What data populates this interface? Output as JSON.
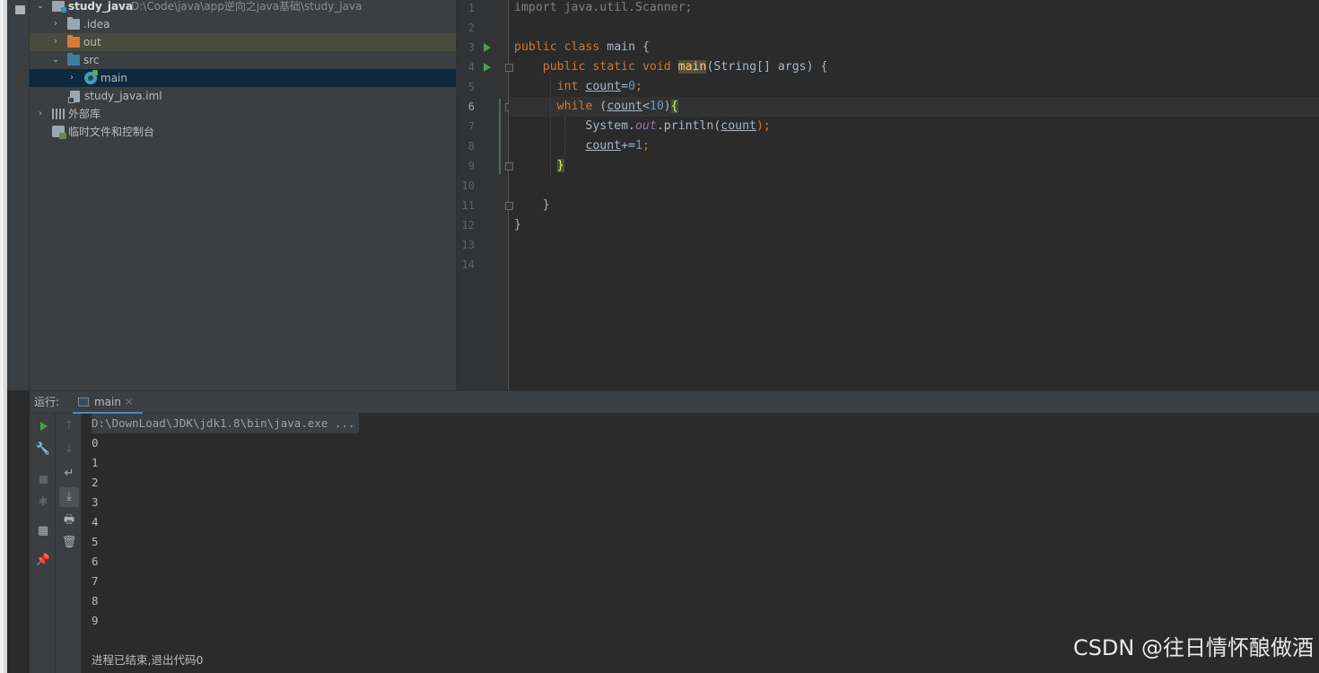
{
  "project": {
    "items": [
      {
        "arrow": "⌄",
        "label": "study_java",
        "path": "D:\\Code\\java\\app逆向之java基础\\study_java"
      },
      {
        "arrow": "›",
        "label": ".idea"
      },
      {
        "arrow": "›",
        "label": "out"
      },
      {
        "arrow": "⌄",
        "label": "src"
      },
      {
        "arrow": "›",
        "label": "main"
      },
      {
        "arrow": "",
        "label": "study_java.iml"
      },
      {
        "arrow": "›",
        "label": "外部库"
      },
      {
        "arrow": "",
        "label": "临时文件和控制台"
      }
    ]
  },
  "editor": {
    "line_numbers": [
      "1",
      "2",
      "3",
      "4",
      "5",
      "6",
      "7",
      "8",
      "9",
      "10",
      "11",
      "12",
      "13",
      "14"
    ],
    "current_line": "6",
    "lines": {
      "l1": {
        "text": "import java.util.Scanner;"
      },
      "l3": {
        "kw1": "public",
        "kw2": "class",
        "rest": "main {"
      },
      "l4": {
        "kw1": "public",
        "kw2": "static",
        "kw3": "void",
        "fn": "main",
        "rest": "(String[] args) {"
      },
      "l5": {
        "kw": "int",
        "var": "count",
        "op": "=",
        "num": "0",
        "end": ";"
      },
      "l6": {
        "kw": "while",
        "open": " (",
        "var": "count",
        "op": "<",
        "num": "10",
        "close": ")",
        "brace": "{"
      },
      "l7": {
        "obj": "System.",
        "field": "out",
        "call": ".println(",
        "var": "count",
        "end": ");"
      },
      "l8": {
        "var": "count",
        "op": "+=",
        "num": "1",
        "end": ";"
      },
      "l9": {
        "brace": "}"
      },
      "l11": {
        "text": "}"
      },
      "l12": {
        "text": "}"
      }
    }
  },
  "run": {
    "title": "运行:",
    "tab_label": "main",
    "tab_close": "×",
    "command": "D:\\DownLoad\\JDK\\jdk1.8\\bin\\java.exe ...",
    "output": [
      "0",
      "1",
      "2",
      "3",
      "4",
      "5",
      "6",
      "7",
      "8",
      "9"
    ],
    "exit_message": "进程已结束,退出代码0"
  },
  "toolbar": {
    "left": [
      "play-icon",
      "wrench-icon",
      "stop-icon",
      "debug-icon",
      "layout-icon",
      "pin-icon"
    ],
    "right": [
      "up-arrow-icon",
      "down-arrow-icon",
      "soft-wrap-icon",
      "scroll-to-end-icon",
      "print-icon",
      "trash-icon"
    ]
  },
  "watermark": "CSDN @往日情怀酿做酒"
}
